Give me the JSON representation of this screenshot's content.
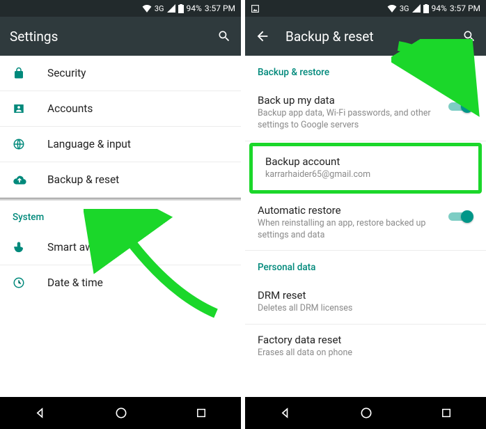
{
  "status": {
    "network_label": "3G",
    "battery_pct": "94%",
    "time": "3:57 PM"
  },
  "left": {
    "title": "Settings",
    "items": {
      "security": "Security",
      "accounts": "Accounts",
      "language": "Language & input",
      "backup": "Backup & reset",
      "smart_awake": "Smart awake",
      "date_time": "Date & time"
    },
    "section_system": "System"
  },
  "right": {
    "title": "Backup & reset",
    "section_backup": "Backup & restore",
    "section_personal": "Personal data",
    "backup_data": {
      "title": "Back up my data",
      "sub": "Backup app data, Wi-Fi passwords, and other settings to Google servers"
    },
    "backup_account": {
      "title": "Backup account",
      "sub": "karrarhaider65@gmail.com"
    },
    "auto_restore": {
      "title": "Automatic restore",
      "sub": "When reinstalling an app, restore backed up settings and data"
    },
    "drm_reset": {
      "title": "DRM reset",
      "sub": "Deletes all DRM licenses"
    },
    "factory": {
      "title": "Factory data reset",
      "sub": "Erases all data on phone"
    }
  }
}
